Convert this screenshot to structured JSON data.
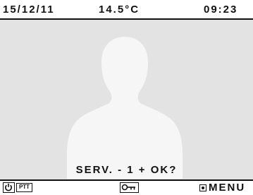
{
  "status_bar": {
    "date": "15/12/11",
    "temperature": "14.5°C",
    "time": "09:23"
  },
  "caller": {
    "avatar_icon": "person-silhouette-icon"
  },
  "prompt": {
    "text": "SERV. - 1 + OK?"
  },
  "softkeys": {
    "power_icon": "power-icon",
    "ptt_label": "PTT",
    "key_icon": "key-icon",
    "menu_label": "MENU"
  },
  "colors": {
    "screen_background": "#e3e3e3",
    "bar_background": "#ffffff",
    "foreground": "#111111",
    "silhouette": "#f6f6f6"
  }
}
